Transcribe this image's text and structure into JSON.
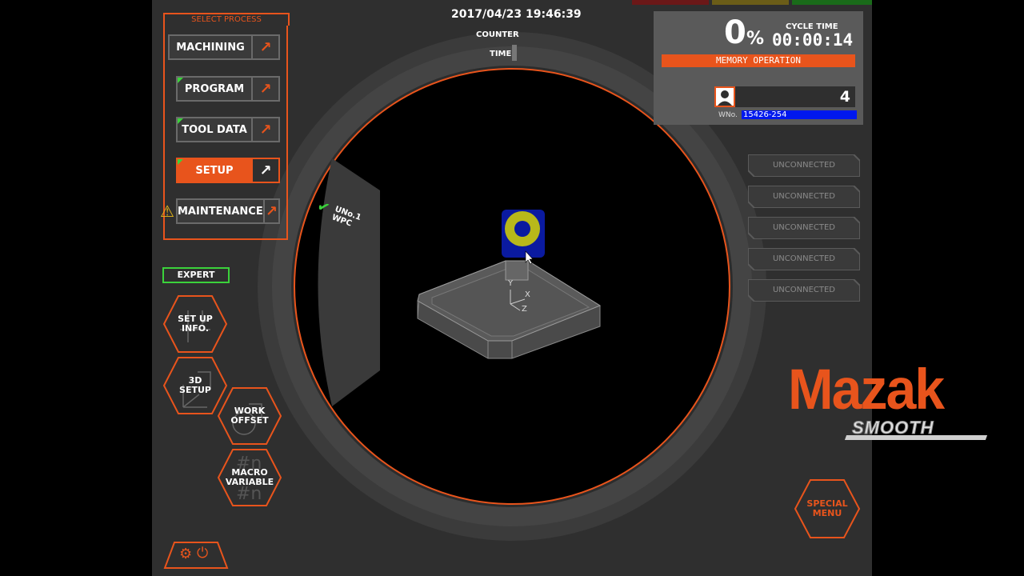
{
  "header": {
    "datetime": "2017/04/23 19:46:39",
    "counter_label": "COUNTER",
    "time_label": "TIME"
  },
  "status_bar_colors": [
    "#7a1a1a",
    "#7a6a1a",
    "#1a7a1a"
  ],
  "select_process": {
    "title": "SELECT PROCESS",
    "buttons": [
      {
        "label": "MACHINING",
        "active": false
      },
      {
        "label": "PROGRAM",
        "active": false
      },
      {
        "label": "TOOL DATA",
        "active": false
      },
      {
        "label": "SETUP",
        "active": true
      },
      {
        "label": "MAINTENANCE",
        "active": false
      }
    ]
  },
  "expert_label": "EXPERT",
  "hex_buttons": {
    "setup_info": "SET UP\nINFO.",
    "setup_3d": "3D\nSETUP",
    "work_offset": "WORK\nOFFSET",
    "macro_variable": "MACRO\nVARIABLE",
    "special_menu": "SPECIAL\nMENU"
  },
  "work_view": {
    "wpc_label": "UNo.1\nWPC",
    "axis_y": "Y",
    "axis_x": "X",
    "axis_z": "Z"
  },
  "cycle": {
    "percent": "0",
    "percent_symbol": "%",
    "cycle_time_label": "CYCLE TIME",
    "cycle_time": "00:00:14",
    "mode": "MEMORY OPERATION",
    "operator_number": "4",
    "wno_label": "WNo.",
    "wno_value": "15426-254"
  },
  "connections": [
    "UNCONNECTED",
    "UNCONNECTED",
    "UNCONNECTED",
    "UNCONNECTED",
    "UNCONNECTED"
  ],
  "logo": {
    "brand": "Mazak",
    "sub": "SMOOTH"
  },
  "colors": {
    "accent": "#e8541c",
    "panel": "#2f2f2f",
    "ok": "#3bd23b",
    "wno_bg": "#0018ee"
  }
}
